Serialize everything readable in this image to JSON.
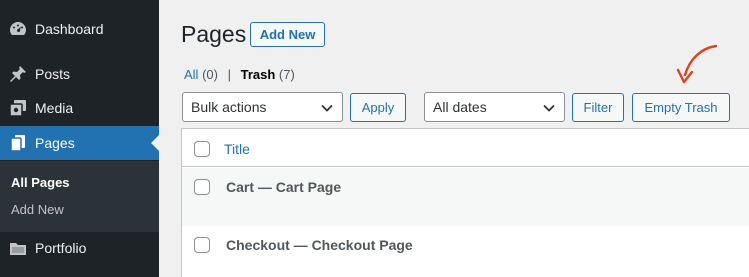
{
  "sidebar": {
    "items": [
      {
        "label": "Dashboard",
        "icon": "dashboard-icon"
      },
      {
        "label": "Posts",
        "icon": "pushpin-icon"
      },
      {
        "label": "Media",
        "icon": "media-icon"
      },
      {
        "label": "Pages",
        "icon": "pages-icon",
        "current": true
      },
      {
        "label": "Portfolio",
        "icon": "folder-icon"
      }
    ],
    "submenu": [
      {
        "label": "All Pages",
        "active": true
      },
      {
        "label": "Add New"
      }
    ],
    "colors": {
      "background": "#1d2327",
      "active": "#2271b1",
      "submenu": "#2c3338"
    }
  },
  "header": {
    "title": "Pages",
    "add_new_label": "Add New"
  },
  "filters": {
    "all_label": "All",
    "all_count": "(0)",
    "separator": "|",
    "trash_label": "Trash",
    "trash_count": "(7)"
  },
  "toolbar": {
    "bulk_actions_value": "Bulk actions",
    "apply_label": "Apply",
    "dates_value": "All dates",
    "filter_label": "Filter",
    "empty_trash_label": "Empty Trash"
  },
  "table": {
    "columns": [
      "Title"
    ],
    "rows": [
      {
        "title": "Cart — Cart Page"
      },
      {
        "title": "Checkout — Checkout Page"
      }
    ]
  },
  "annotation": {
    "color": "#e2401c"
  }
}
